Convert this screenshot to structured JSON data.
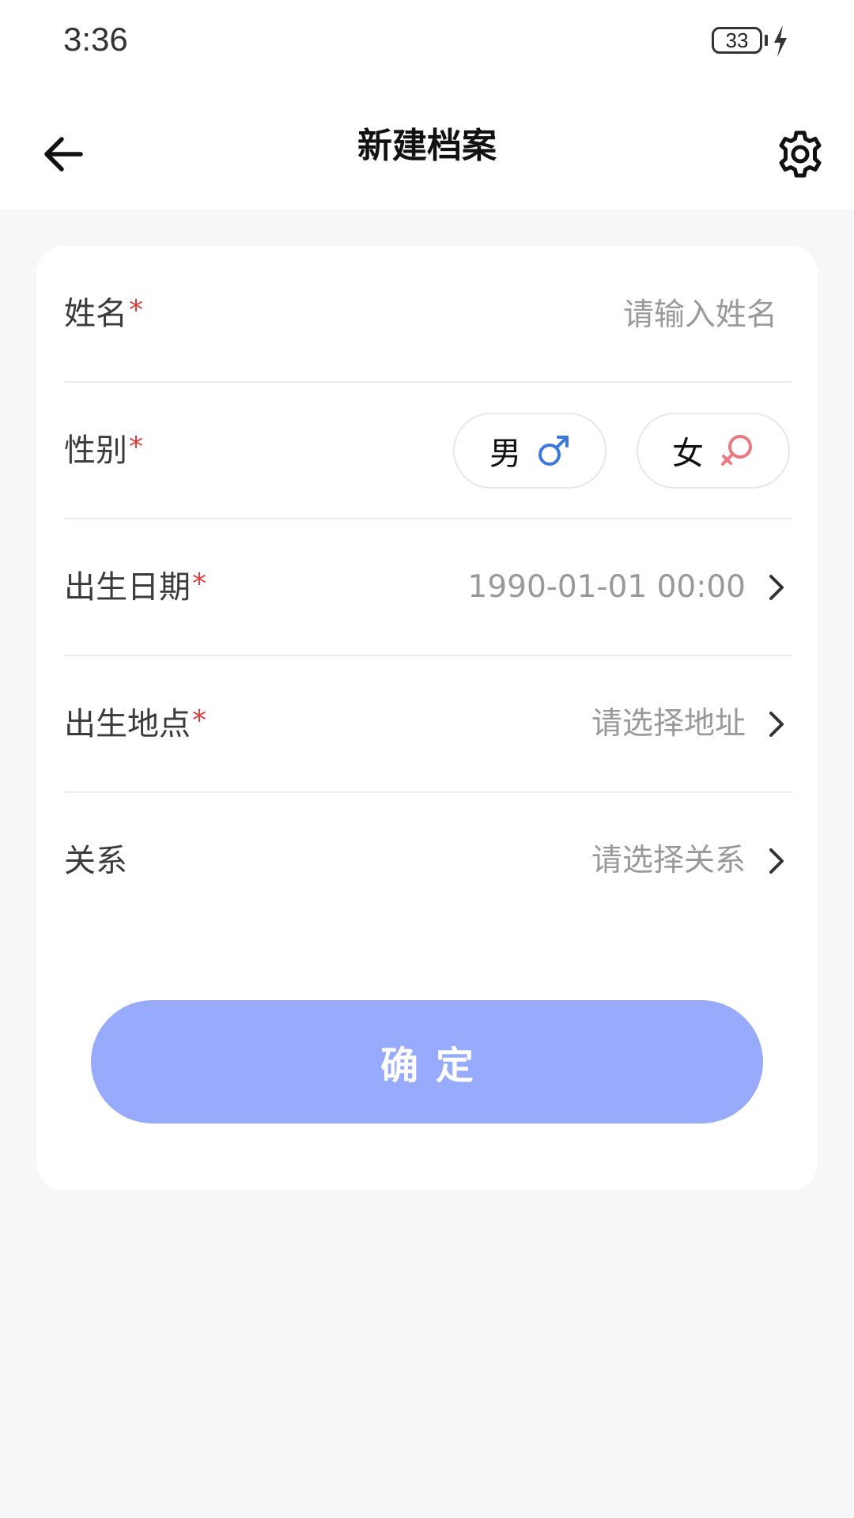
{
  "status_bar": {
    "time": "3:36",
    "battery_level": "33"
  },
  "header": {
    "title": "新建档案",
    "back_icon": "arrow-left-icon",
    "settings_icon": "gear-icon"
  },
  "form": {
    "required_mark": "*",
    "name": {
      "label": "姓名",
      "placeholder": "请输入姓名",
      "value": ""
    },
    "gender": {
      "label": "性别",
      "options": [
        {
          "label": "男",
          "icon": "male-symbol-icon",
          "color": "#3a78e0"
        },
        {
          "label": "女",
          "icon": "female-symbol-icon",
          "color": "#e97a82"
        }
      ]
    },
    "birth_date": {
      "label": "出生日期",
      "value": "1990-01-01 00:00"
    },
    "birth_place": {
      "label": "出生地点",
      "placeholder": "请选择地址"
    },
    "relation": {
      "label": "关系",
      "placeholder": "请选择关系"
    }
  },
  "confirm_button": {
    "label": "确定",
    "color": "#97aafc"
  },
  "colors": {
    "required": "#e23d3d",
    "background": "#f6f7f9",
    "placeholder": "#999999"
  }
}
